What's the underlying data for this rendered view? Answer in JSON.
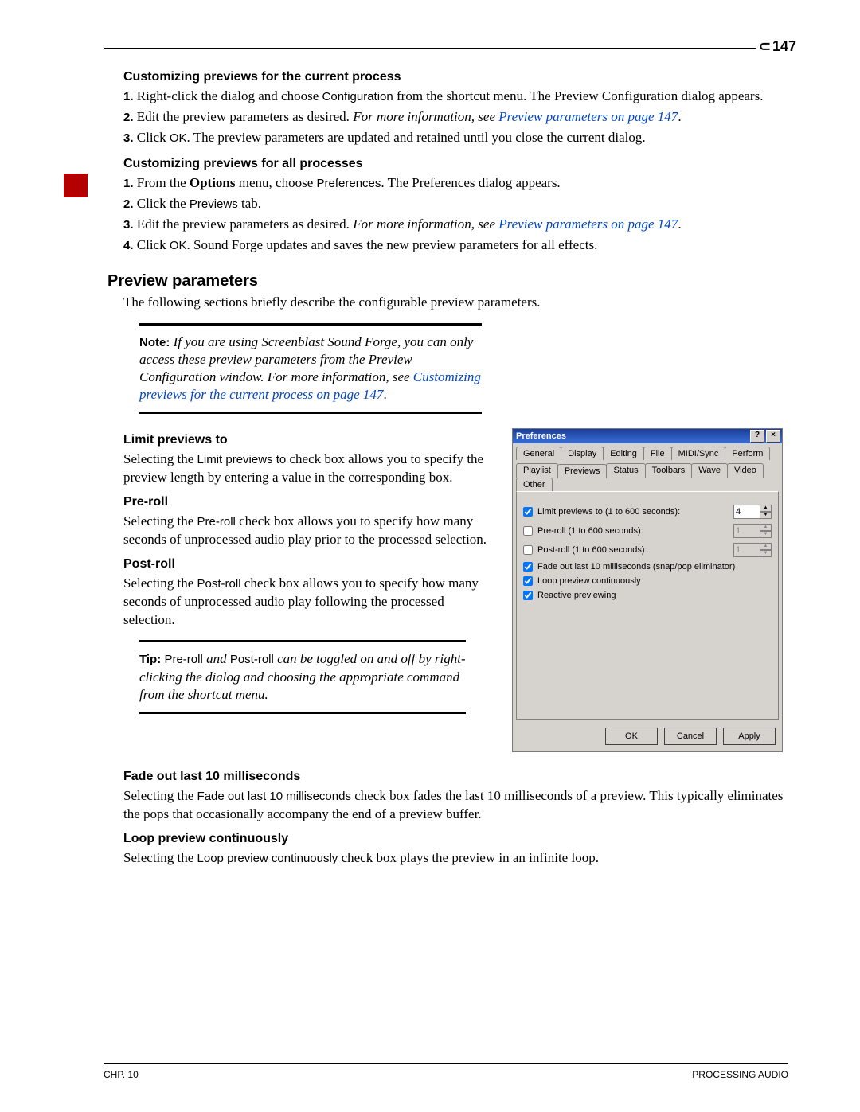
{
  "page_number": "147",
  "footer": {
    "left": "CHP. 10",
    "right": "PROCESSING AUDIO"
  },
  "sec1": {
    "title": "Customizing previews for the current process",
    "steps": [
      {
        "n": "1.",
        "pre": "Right-click the dialog and choose ",
        "ui": "Configuration",
        "post": " from the shortcut menu. The Preview Configuration dialog appears."
      },
      {
        "n": "2.",
        "pre": "Edit the preview parameters as desired. ",
        "ital": "For more information, see ",
        "link": "Preview parameters",
        "link_post": " on page 147",
        "post": "."
      },
      {
        "n": "3.",
        "pre": "Click ",
        "ui": "OK",
        "post": ". The preview parameters are updated and retained until you close the current dialog."
      }
    ]
  },
  "sec2": {
    "title": "Customizing previews for all processes",
    "steps": [
      {
        "n": "1.",
        "pre": "From the ",
        "bold": "Options",
        "mid": " menu, choose ",
        "ui": "Preferences",
        "post": ". The Preferences dialog appears."
      },
      {
        "n": "2.",
        "pre": "Click the ",
        "ui": "Previews",
        "post": " tab."
      },
      {
        "n": "3.",
        "pre": "Edit the preview parameters as desired. ",
        "ital": "For more information, see ",
        "link": "Preview parameters",
        "link_post": " on page 147",
        "post": "."
      },
      {
        "n": "4.",
        "pre": "Click ",
        "ui": "OK",
        "post": ". Sound Forge updates and saves the new preview parameters for all effects."
      }
    ]
  },
  "sec3": {
    "title": "Preview parameters",
    "intro": "The following sections briefly describe the configurable preview parameters.",
    "note_label": "Note:",
    "note_body1": " If you are using Screenblast Sound Forge, you can only access these preview parameters from the Preview Configuration window. For more information, see ",
    "note_link": "Customizing previews for the current process",
    "note_link_post": " on page 147",
    "note_tail": "."
  },
  "limit": {
    "title": "Limit previews to",
    "body_a": "Selecting the ",
    "ui": "Limit previews to",
    "body_b": " check box allows you to specify the preview length by entering a value in the corresponding box."
  },
  "preroll": {
    "title": "Pre-roll",
    "body_a": "Selecting the ",
    "ui": "Pre-roll",
    "body_b": " check box allows you to specify how many seconds of unprocessed audio play prior to the processed selection."
  },
  "postroll": {
    "title": "Post-roll",
    "body_a": "Selecting the ",
    "ui": "Post-roll",
    "body_b": " check box allows you to specify how many seconds of unprocessed audio play following the processed selection."
  },
  "tip": {
    "label": "Tip:",
    "pre": " ",
    "ui1": "Pre-roll",
    "mid1": " and ",
    "ui2": "Post-roll",
    "body": " can be toggled on and off by right-clicking the dialog and choosing the appropriate command from the shortcut menu."
  },
  "fade": {
    "title": "Fade out last 10 milliseconds",
    "body_a": "Selecting the ",
    "ui": "Fade out last 10 milliseconds",
    "body_b": " check box fades the last 10 milliseconds of a preview. This typically eliminates the pops that occasionally accompany the end of a preview buffer."
  },
  "loop": {
    "title": "Loop preview continuously",
    "body_a": "Selecting the ",
    "ui": "Loop preview continuously",
    "body_b": " check box plays the preview in an infinite loop."
  },
  "dialog": {
    "title": "Preferences",
    "tabs_row1": [
      "General",
      "Display",
      "Editing",
      "File",
      "MIDI/Sync",
      "Perform"
    ],
    "tabs_row2": [
      "Playlist",
      "Previews",
      "Status",
      "Toolbars",
      "Wave",
      "Video",
      "Other"
    ],
    "active_tab": "Previews",
    "chk_limit": "Limit previews to (1 to 600 seconds):",
    "val_limit": "4",
    "chk_preroll": "Pre-roll (1 to 600 seconds):",
    "val_preroll": "1",
    "chk_postroll": "Post-roll (1 to 600 seconds):",
    "val_postroll": "1",
    "chk_fade": "Fade out last 10 milliseconds (snap/pop eliminator)",
    "chk_loop": "Loop preview continuously",
    "chk_reactive": "Reactive previewing",
    "btn_ok": "OK",
    "btn_cancel": "Cancel",
    "btn_apply": "Apply"
  }
}
